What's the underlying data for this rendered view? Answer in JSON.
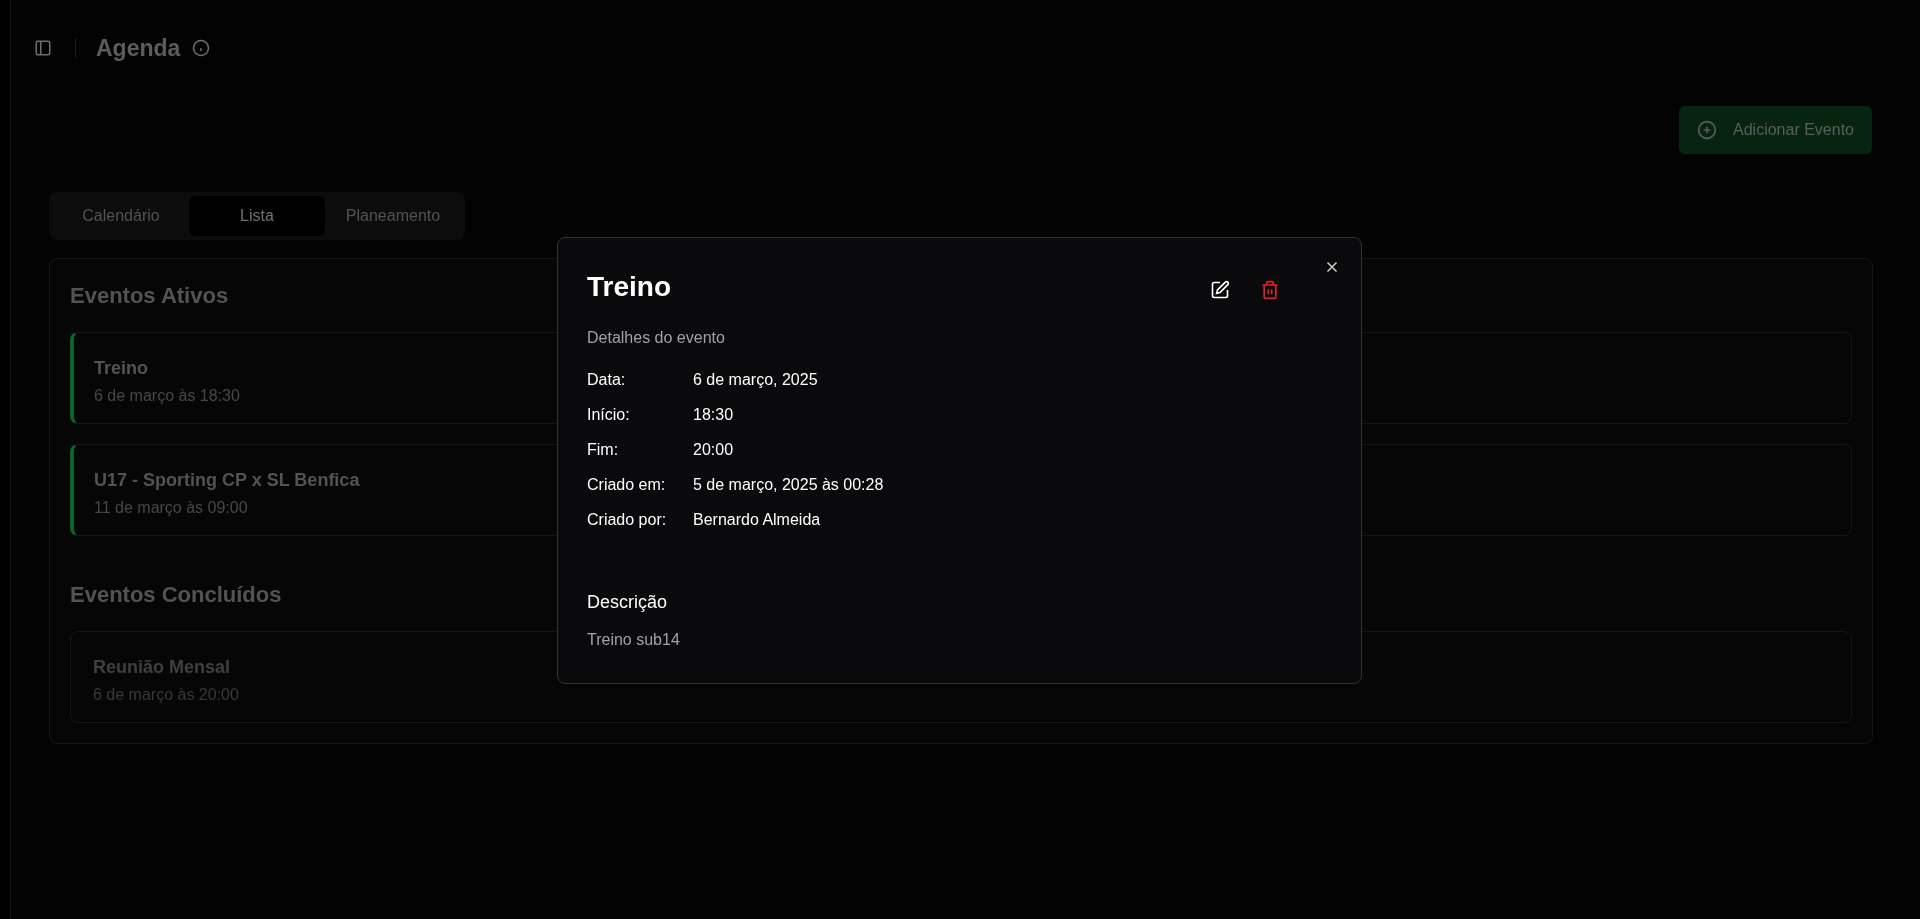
{
  "header": {
    "title": "Agenda"
  },
  "add_button": {
    "label": "Adicionar Evento"
  },
  "tabs": [
    {
      "label": "Calendário",
      "selected": false
    },
    {
      "label": "Lista",
      "selected": true
    },
    {
      "label": "Planeamento",
      "selected": false
    }
  ],
  "sections": [
    {
      "title": "Eventos Ativos",
      "events": [
        {
          "title": "Treino",
          "when": "6 de março às 18:30",
          "completed": false
        },
        {
          "title": "U17 - Sporting CP x SL Benfica",
          "when": "11 de março às 09:00",
          "completed": false
        }
      ]
    },
    {
      "title": "Eventos Concluídos",
      "events": [
        {
          "title": "Reunião Mensal",
          "when": "6 de março às 20:00",
          "completed": true
        }
      ]
    }
  ],
  "dialog": {
    "title": "Treino",
    "subtitle": "Detalhes do evento",
    "fields": [
      {
        "label": "Data:",
        "value": "6 de março, 2025"
      },
      {
        "label": "Início:",
        "value": "18:30"
      },
      {
        "label": "Fim:",
        "value": "20:00"
      },
      {
        "label": "Criado em:",
        "value": "5 de março, 2025 às 00:28"
      },
      {
        "label": "Criado por:",
        "value": "Bernardo Almeida"
      }
    ],
    "description_heading": "Descrição",
    "description": "Treino sub14"
  }
}
